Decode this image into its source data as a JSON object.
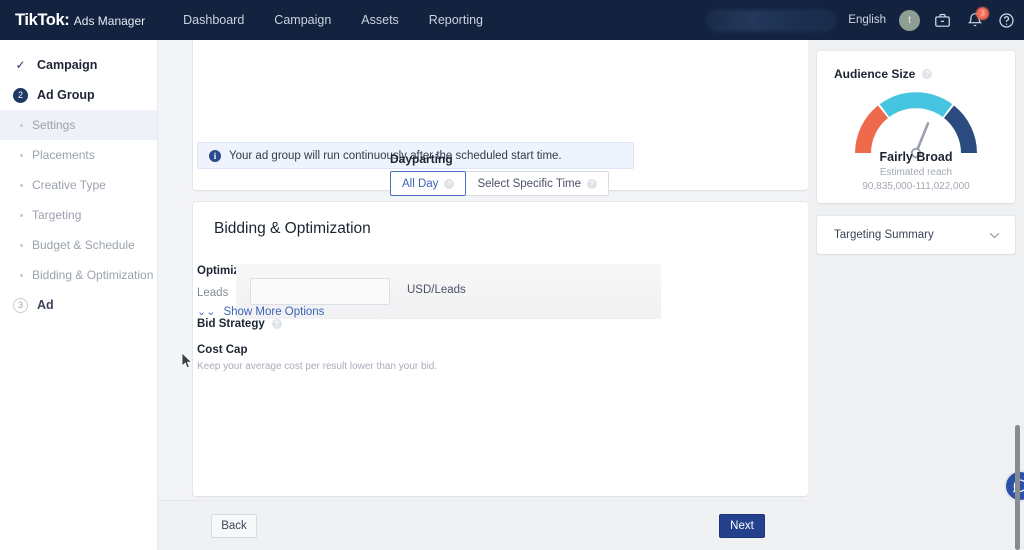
{
  "topnav": {
    "brand_name": "TikTok",
    "brand_colon": ":",
    "brand_sub": "Ads Manager",
    "links": [
      {
        "label": "Dashboard"
      },
      {
        "label": "Campaign"
      },
      {
        "label": "Assets"
      },
      {
        "label": "Reporting"
      }
    ],
    "account_pill_value": "",
    "language": "English",
    "avatar_initial": "t",
    "icons": {
      "briefcase": "briefcase-icon",
      "bell": "bell-icon",
      "help": "help-icon"
    },
    "notification_badge": "3",
    "background_color": "#13233f"
  },
  "sidebar": {
    "steps": [
      {
        "badge": "✓",
        "badge_type": "done",
        "label": "Campaign"
      },
      {
        "badge": "2",
        "badge_type": "active",
        "label": "Ad Group"
      },
      {
        "badge": "3",
        "badge_type": "idle",
        "label": "Ad"
      }
    ],
    "substeps": [
      {
        "label": "Settings",
        "selected": true
      },
      {
        "label": "Placements",
        "selected": false
      },
      {
        "label": "Creative Type",
        "selected": false
      },
      {
        "label": "Targeting",
        "selected": false
      },
      {
        "label": "Budget & Schedule",
        "selected": false
      },
      {
        "label": "Bidding & Optimization",
        "selected": false
      }
    ]
  },
  "schedule_card": {
    "info_banner": "Your ad group will run continuously after the scheduled start time.",
    "dayparting_label": "Dayparting",
    "options": [
      {
        "label": "All Day",
        "selected": true
      },
      {
        "label": "Select Specific Time",
        "selected": false
      }
    ]
  },
  "bidding_card": {
    "title": "Bidding & Optimization",
    "optimization_goal_label": "Optimization Goal",
    "optimization_goal_value": "Leads",
    "bid_strategy_label": "Bid Strategy",
    "cost_cap_label": "Cost Cap",
    "cost_cap_hint": "Keep your average cost per result lower than your bid.",
    "bid_input_value": "",
    "bid_input_placeholder": "",
    "bid_unit": "USD/Leads",
    "show_more_label": "Show More Options"
  },
  "right_panel": {
    "audience": {
      "title": "Audience Size",
      "gauge_label": "Fairly Broad",
      "reach_label": "Estimated reach",
      "reach_value": "90,835,000-111,022,000",
      "gauge_colors": {
        "low": "#ef6a4c",
        "mid": "#45c5e0",
        "high": "#2b4b80"
      },
      "needle_angle_deg": 22
    },
    "targeting_summary": {
      "label": "Targeting Summary",
      "expanded": false
    }
  },
  "footer": {
    "back_label": "Back",
    "next_label": "Next",
    "next_color": "#23418c"
  },
  "chrome": {
    "scroll_position": "bottom",
    "fab_icon": "chat-bubble-icon"
  }
}
